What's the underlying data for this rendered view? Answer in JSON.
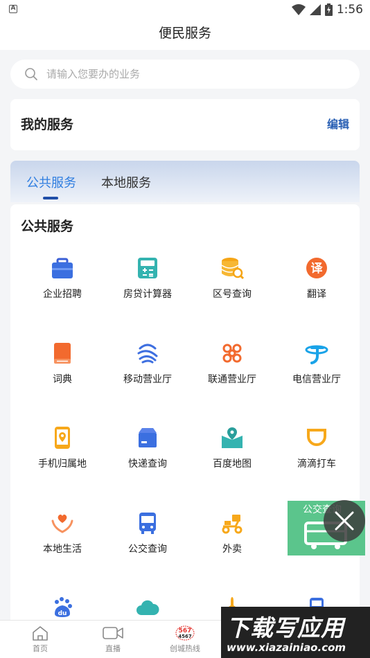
{
  "status_bar": {
    "time": "1:56"
  },
  "header": {
    "title": "便民服务"
  },
  "search": {
    "placeholder": "请输入您要办的业务"
  },
  "my_services": {
    "title": "我的服务",
    "edit_label": "编辑"
  },
  "tabs": [
    {
      "label": "公共服务",
      "active": true
    },
    {
      "label": "本地服务",
      "active": false
    }
  ],
  "section": {
    "title": "公共服务",
    "items": [
      {
        "label": "企业招聘",
        "icon": "briefcase-icon"
      },
      {
        "label": "房贷计算器",
        "icon": "calculator-icon"
      },
      {
        "label": "区号查询",
        "icon": "database-search-icon"
      },
      {
        "label": "翻译",
        "icon": "translate-icon"
      },
      {
        "label": "词典",
        "icon": "book-icon"
      },
      {
        "label": "移动营业厅",
        "icon": "china-mobile-icon"
      },
      {
        "label": "联通营业厅",
        "icon": "china-unicom-icon"
      },
      {
        "label": "电信营业厅",
        "icon": "china-telecom-icon"
      },
      {
        "label": "手机归属地",
        "icon": "phone-location-icon"
      },
      {
        "label": "快递查询",
        "icon": "package-icon"
      },
      {
        "label": "百度地图",
        "icon": "map-icon"
      },
      {
        "label": "滴滴打车",
        "icon": "didi-icon"
      },
      {
        "label": "本地生活",
        "icon": "heart-hands-icon"
      },
      {
        "label": "公交查询",
        "icon": "bus-icon"
      },
      {
        "label": "外卖",
        "icon": "scooter-icon"
      },
      {
        "label": "",
        "icon": "baidu-icon"
      },
      {
        "label": "",
        "icon": "cloud-icon"
      },
      {
        "label": "",
        "icon": "plane-icon"
      },
      {
        "label": "",
        "icon": "train-icon"
      }
    ]
  },
  "floating_ad": {
    "text": "公交查询"
  },
  "tab_bar": [
    {
      "label": "首页",
      "icon": "home-icon"
    },
    {
      "label": "直播",
      "icon": "video-icon"
    },
    {
      "label": "创城热线",
      "icon": "hotline-icon",
      "icon_text_top": "567",
      "icon_text_bottom": "4567"
    }
  ],
  "watermark": {
    "title": "下载写应用",
    "url": "www.xiazainiao.com"
  },
  "colors": {
    "accent": "#2f7ee0",
    "edit": "#2a60b4"
  }
}
